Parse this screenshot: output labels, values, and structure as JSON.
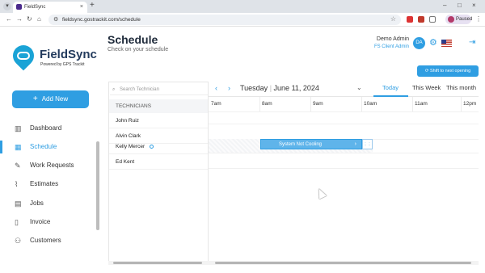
{
  "browser": {
    "tab_title": "FieldSync",
    "url": "fieldsync.gostrackit.com/schedule",
    "profile_label": "Paused"
  },
  "brand": {
    "name": "FieldSync",
    "tagline": "Powered by GPS Trackit",
    "accent": "#2f9ee2"
  },
  "sidebar": {
    "add_button": "Add New",
    "items": [
      {
        "label": "Dashboard",
        "icon": "dashboard-icon"
      },
      {
        "label": "Schedule",
        "icon": "calendar-icon",
        "active": true
      },
      {
        "label": "Work Requests",
        "icon": "wrench-icon"
      },
      {
        "label": "Estimates",
        "icon": "paperclip-icon"
      },
      {
        "label": "Jobs",
        "icon": "document-icon"
      },
      {
        "label": "Invoice",
        "icon": "invoice-icon"
      },
      {
        "label": "Customers",
        "icon": "people-icon"
      }
    ]
  },
  "header": {
    "title": "Schedule",
    "subtitle": "Check on your schedule",
    "user_name": "Demo Admin",
    "user_role": "FS Client Admin",
    "avatar_initials": "DA",
    "shift_button": "Shift to next opening"
  },
  "technicians": {
    "search_placeholder": "Search Technician",
    "header": "TECHNICIANS",
    "rows": [
      "John Ruiz",
      "Alvin Clark",
      "Kelly Mercer",
      "Ed Kent"
    ]
  },
  "calendar": {
    "day": "Tuesday",
    "date": "June 11, 2024",
    "views": [
      "Today",
      "This Week",
      "This month"
    ],
    "active_view": "Today",
    "hours": [
      "7am",
      "8am",
      "9am",
      "10am",
      "11am",
      "12pm"
    ],
    "job": {
      "label": "System Not Cooling"
    }
  }
}
